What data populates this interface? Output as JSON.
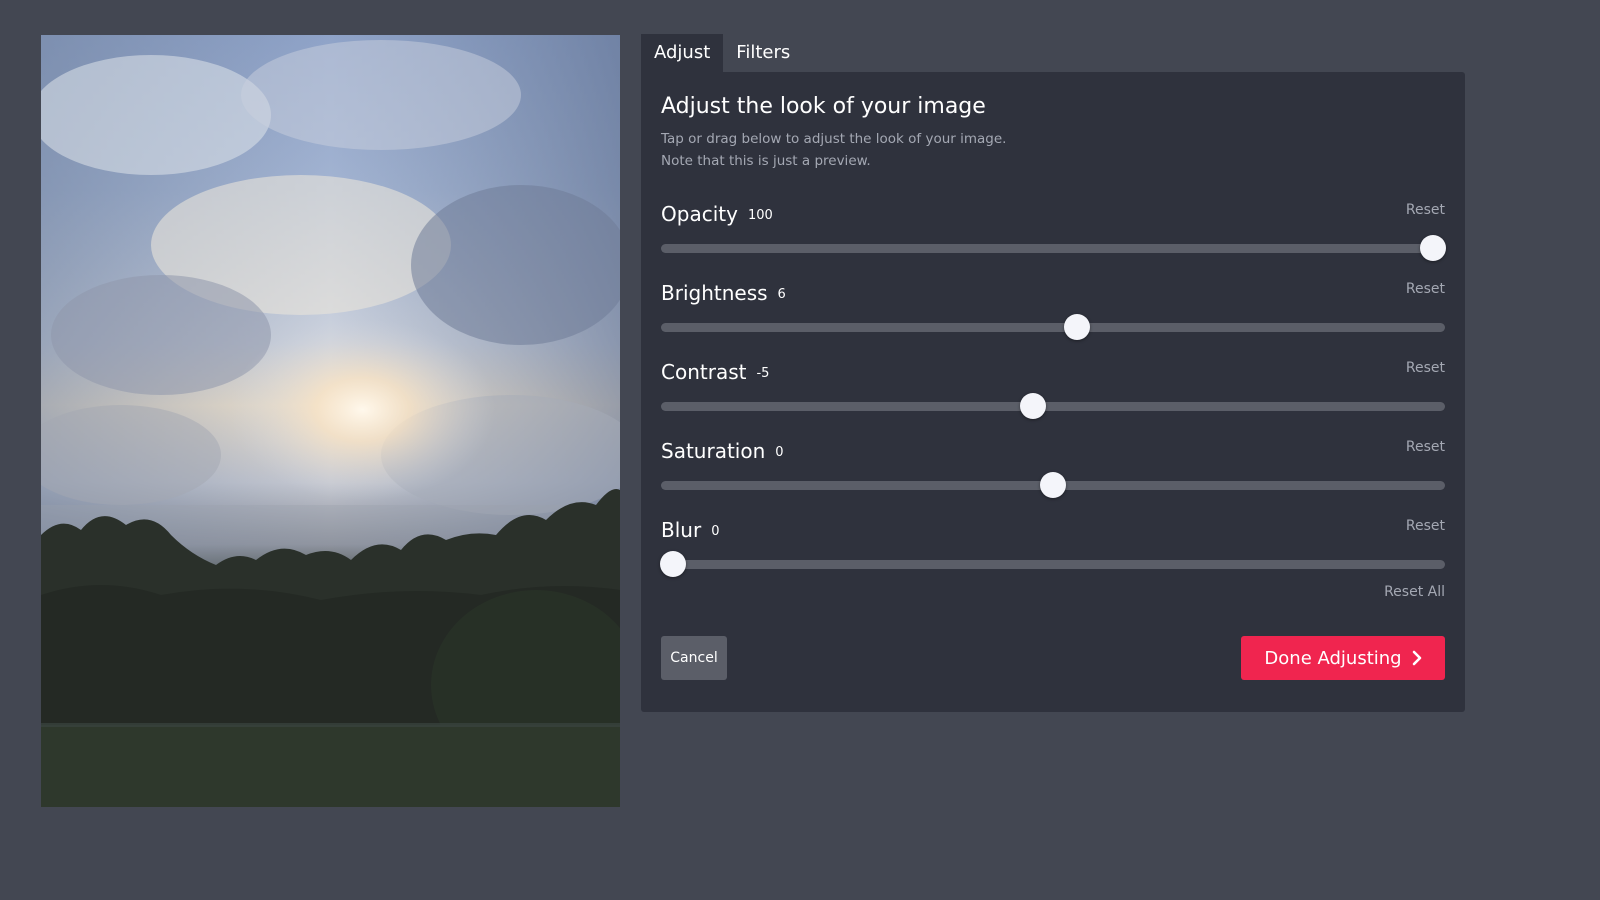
{
  "tabs": [
    {
      "label": "Adjust",
      "active": true
    },
    {
      "label": "Filters",
      "active": false
    }
  ],
  "panel": {
    "title": "Adjust the look of your image",
    "description_line1": "Tap or drag below to adjust the look of your image.",
    "description_line2": "Note that this is just a preview."
  },
  "controls": [
    {
      "label": "Opacity",
      "value": "100",
      "position": 0.985,
      "reset_label": "Reset"
    },
    {
      "label": "Brightness",
      "value": "6",
      "position": 0.53,
      "reset_label": "Reset"
    },
    {
      "label": "Contrast",
      "value": "-5",
      "position": 0.475,
      "reset_label": "Reset"
    },
    {
      "label": "Saturation",
      "value": "0",
      "position": 0.5,
      "reset_label": "Reset"
    },
    {
      "label": "Blur",
      "value": "0",
      "position": 0.015,
      "reset_label": "Reset"
    }
  ],
  "reset_all_label": "Reset All",
  "buttons": {
    "cancel_label": "Cancel",
    "done_label": "Done Adjusting"
  },
  "icons": {
    "done": "chevron-right-icon"
  },
  "colors": {
    "background": "#434752",
    "panel": "#2f323d",
    "track": "#5b5e68",
    "thumb": "#f4f5fa",
    "accent": "#f0254f",
    "muted_text": "#a4a8b3"
  }
}
